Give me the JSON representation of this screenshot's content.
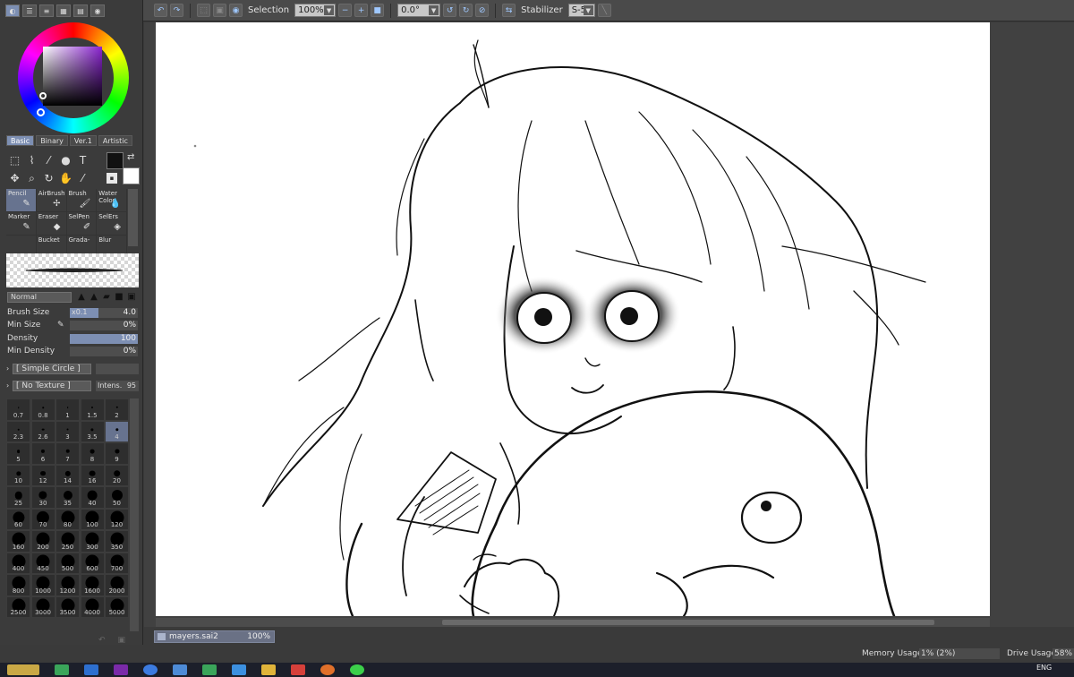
{
  "toolbar": {
    "selection_label": "Selection",
    "zoom": "100%",
    "rotation": "0.0°",
    "stabilizer_label": "Stabilizer",
    "stabilizer_value": "S-5"
  },
  "tool_tabs": [
    "Basic",
    "Binary",
    "Ver.1",
    "Artistic"
  ],
  "brushes": [
    {
      "label": "Pencil",
      "icon": "pencil-icon",
      "glyph": "✎"
    },
    {
      "label": "AirBrush",
      "icon": "airbrush-icon",
      "glyph": "✢"
    },
    {
      "label": "Brush",
      "icon": "brush-icon",
      "glyph": "🖌"
    },
    {
      "label": "Water Color",
      "icon": "water-color-icon",
      "glyph": "💧"
    },
    {
      "label": "Marker",
      "icon": "marker-icon",
      "glyph": "✎"
    },
    {
      "label": "Eraser",
      "icon": "eraser-icon",
      "glyph": "◆"
    },
    {
      "label": "SelPen",
      "icon": "selpen-icon",
      "glyph": "✐"
    },
    {
      "label": "SelErs",
      "icon": "selers-icon",
      "glyph": "◈"
    },
    {
      "label": "",
      "icon": "empty-slot",
      "glyph": ""
    },
    {
      "label": "Bucket",
      "icon": "bucket-icon",
      "glyph": ""
    },
    {
      "label": "Grada-",
      "icon": "gradation-icon",
      "glyph": ""
    },
    {
      "label": "Blur",
      "icon": "blur-icon",
      "glyph": ""
    }
  ],
  "brush_settings": {
    "blend_mode": "Normal",
    "brush_size_label": "Brush Size",
    "brush_size_multiplier": "x0.1",
    "brush_size_value": "4.0",
    "min_size_label": "Min Size",
    "min_size_value": "0%",
    "density_label": "Density",
    "density_value": "100",
    "min_density_label": "Min Density",
    "min_density_value": "0%",
    "shape": "[ Simple Circle ]",
    "texture": "[ No Texture ]",
    "intens_label": "Intens.",
    "intens_value": "95"
  },
  "brush_sizes": [
    "0.7",
    "0.8",
    "1",
    "1.5",
    "2",
    "2.3",
    "2.6",
    "3",
    "3.5",
    "4",
    "5",
    "6",
    "7",
    "8",
    "9",
    "10",
    "12",
    "14",
    "16",
    "20",
    "25",
    "30",
    "35",
    "40",
    "50",
    "60",
    "70",
    "80",
    "100",
    "120",
    "160",
    "200",
    "250",
    "300",
    "350",
    "400",
    "450",
    "500",
    "600",
    "700",
    "800",
    "1000",
    "1200",
    "1600",
    "2000",
    "2500",
    "3000",
    "3500",
    "4000",
    "5000"
  ],
  "selected_size": "4",
  "document": {
    "name": "mayers.sai2",
    "zoom": "100%"
  },
  "status": {
    "memory_label": "Memory Usage",
    "memory_value": "1% (2%)",
    "drive_label": "Drive Usage",
    "drive_value": "58%"
  },
  "taskbar": {
    "language": "ENG"
  },
  "colors": {
    "accent": "#7d8fb3",
    "foreground": "#111111",
    "background": "#ffffff"
  }
}
